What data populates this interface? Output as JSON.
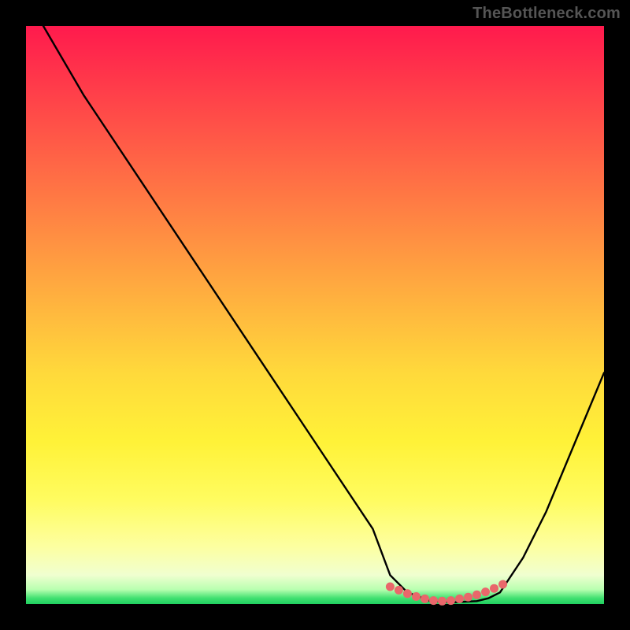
{
  "watermark": "TheBottleneck.com",
  "chart_data": {
    "type": "line",
    "title": "",
    "xlabel": "",
    "ylabel": "",
    "x_range": [
      0,
      100
    ],
    "y_range": [
      0,
      100
    ],
    "series": [
      {
        "name": "bottleneck-curve",
        "x": [
          3,
          10,
          20,
          30,
          40,
          50,
          60,
          63,
          66,
          70,
          74,
          78,
          80,
          82,
          86,
          90,
          95,
          100
        ],
        "y": [
          100,
          88,
          73,
          58,
          43,
          28,
          13,
          5,
          2,
          0.5,
          0.3,
          0.5,
          1,
          2,
          8,
          16,
          28,
          40
        ]
      }
    ],
    "valley_markers": {
      "name": "optimal-range-dots",
      "x": [
        63,
        64.5,
        66,
        67.5,
        69,
        70.5,
        72,
        73.5,
        75,
        76.5,
        78,
        79.5,
        81,
        82.5
      ],
      "y": [
        3.0,
        2.4,
        1.8,
        1.3,
        0.9,
        0.6,
        0.5,
        0.6,
        0.9,
        1.2,
        1.6,
        2.1,
        2.7,
        3.4
      ]
    },
    "colors": {
      "curve": "#000000",
      "dots": "#e9676b",
      "gradient_top": "#ff1a4d",
      "gradient_mid": "#ffd93b",
      "gradient_bottom": "#20d060"
    }
  }
}
